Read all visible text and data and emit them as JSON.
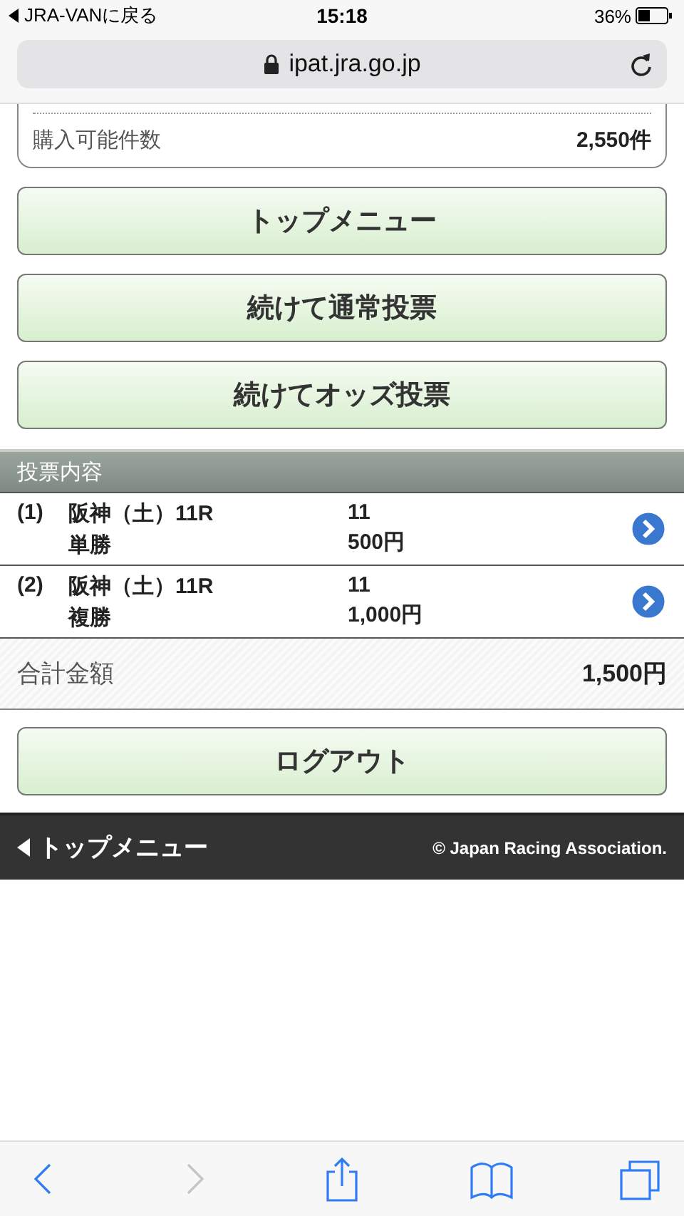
{
  "status_bar": {
    "back_link": "JRA-VANに戻る",
    "time": "15:18",
    "battery": "36%"
  },
  "address_bar": {
    "url": "ipat.jra.go.jp"
  },
  "summary": {
    "label": "購入可能件数",
    "value": "2,550件"
  },
  "menu_buttons": [
    "トップメニュー",
    "続けて通常投票",
    "続けてオッズ投票"
  ],
  "bets": {
    "title": "投票内容",
    "rows": [
      {
        "number": "(1)",
        "race": "阪神（土）11R",
        "bet_type": "単勝",
        "horse": "11",
        "amount": "500円"
      },
      {
        "number": "(2)",
        "race": "阪神（土）11R",
        "bet_type": "複勝",
        "horse": "11",
        "amount": "1,000円"
      }
    ],
    "total_label": "合計金額",
    "total_value": "1,500円"
  },
  "logout_button": "ログアウト",
  "footer": {
    "link": "トップメニュー",
    "copyright": "© Japan Racing Association."
  },
  "toolbar": [
    {
      "kind": "back",
      "disabled": false
    },
    {
      "kind": "forward",
      "disabled": true
    },
    {
      "kind": "share",
      "disabled": false
    },
    {
      "kind": "bookmarks",
      "disabled": false
    },
    {
      "kind": "tabs",
      "disabled": false
    }
  ]
}
